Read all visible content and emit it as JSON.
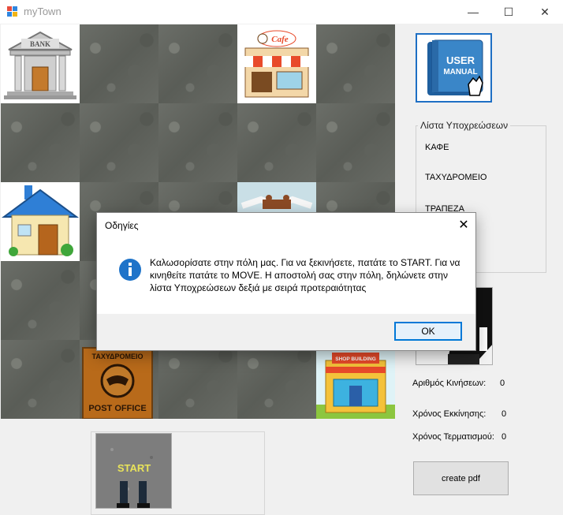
{
  "window": {
    "title": "myTown",
    "minimize_glyph": "—",
    "maximize_glyph": "☐",
    "close_glyph": "✕"
  },
  "board": {
    "tiles": [
      "bank",
      "stone",
      "stone",
      "cafe",
      "stone",
      "stone",
      "stone",
      "stone",
      "stone",
      "stone",
      "house",
      "stone",
      "stone",
      "animal-shelter",
      "stone",
      "stone",
      "stone",
      "stone",
      "stone",
      "stone",
      "stone",
      "post-office",
      "stone",
      "stone",
      "shop-building"
    ],
    "bank_sign": "BANK",
    "cafe_sign": "Cafe",
    "post_sign_top": "ΤΑΧΥΔΡΟΜΕΙΟ",
    "post_sign_bottom": "POST OFFICE",
    "shop_sign": "SHOP BUILDING"
  },
  "manual": {
    "line1": "USER",
    "line2": "MANUAL"
  },
  "duties": {
    "title": "Λίστα Υποχρεώσεων",
    "items": [
      "ΚΑΦΕ",
      "ΤΑΧΥΔΡΟΜΕΙΟ",
      "ΤΡΑΠΕΖΑ"
    ]
  },
  "stats": {
    "moves_label": "Αριθμός Κινήσεων:",
    "moves_value": "0",
    "start_time_label": "Χρόνος Εκκίνησης:",
    "start_time_value": "0",
    "end_time_label": "Χρόνος Τερματισμού:",
    "end_time_value": "0"
  },
  "buttons": {
    "create_pdf": "create pdf",
    "start_text": "START"
  },
  "dialog": {
    "title": "Οδηγίες",
    "message": "Καλωσορίσατε στην πόλη μας. Για να ξεκινήσετε, πατάτε το START. Για να κινηθείτε πατάτε το MOVE. Η αποστολή σας στην πόλη, δηλώνετε στην λίστα Υποχρεώσεων δεξιά με σειρά προτεραιότητας",
    "ok_label": "OK",
    "close_glyph": "✕",
    "icon": "info-icon"
  },
  "colors": {
    "accent": "#0078d7",
    "info_icon": "#1e73c9"
  }
}
